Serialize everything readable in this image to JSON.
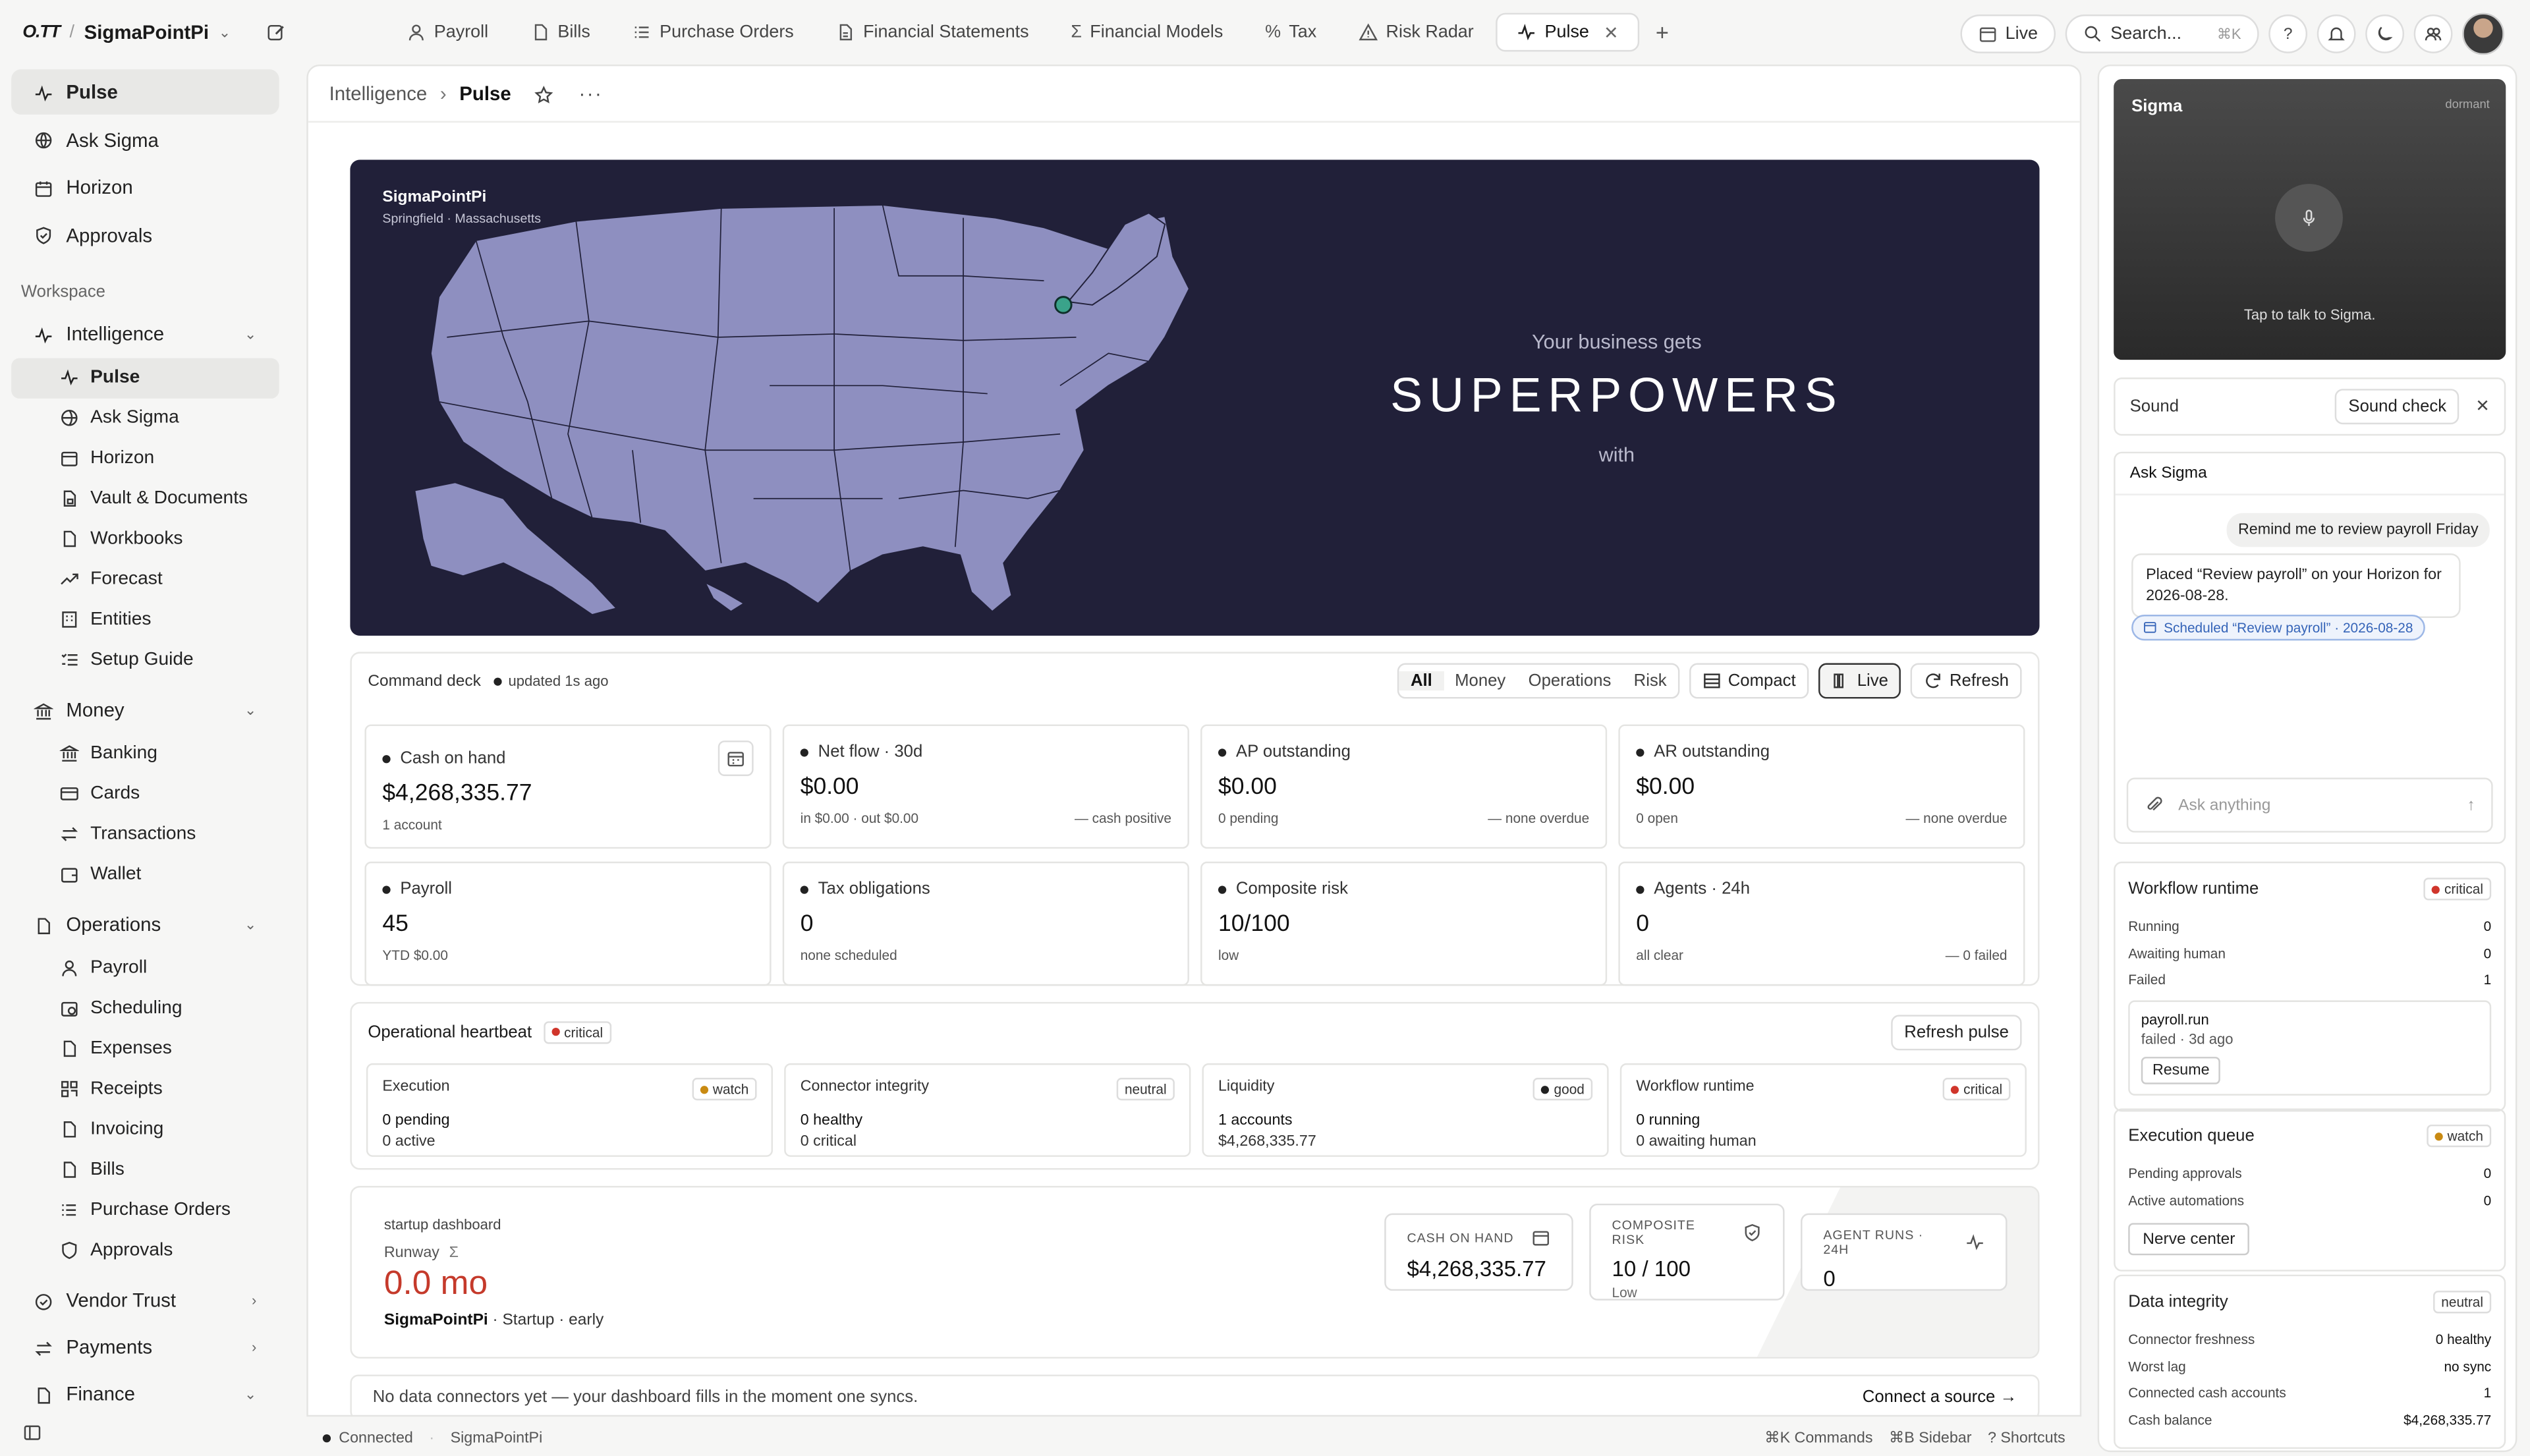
{
  "app": {
    "logo": "O.TT",
    "org": "SigmaPointPi"
  },
  "tabs": [
    {
      "label": "Payroll",
      "icon": "users-icon"
    },
    {
      "label": "Bills",
      "icon": "file-icon"
    },
    {
      "label": "Purchase Orders",
      "icon": "list-icon"
    },
    {
      "label": "Financial Statements",
      "icon": "document-icon"
    },
    {
      "label": "Financial Models",
      "icon": "sigma-icon"
    },
    {
      "label": "Tax",
      "icon": "percent-icon"
    },
    {
      "label": "Risk Radar",
      "icon": "warning-icon"
    },
    {
      "label": "Pulse",
      "icon": "pulse-icon",
      "active": true
    }
  ],
  "topright": {
    "live": "Live",
    "search_placeholder": "Search...",
    "search_kbd": "⌘K"
  },
  "sidebar": {
    "top": [
      "Pulse",
      "Ask Sigma",
      "Horizon",
      "Approvals"
    ],
    "workspace_label": "Workspace",
    "intelligence": {
      "label": "Intelligence",
      "items": [
        "Pulse",
        "Ask Sigma",
        "Horizon",
        "Vault & Documents",
        "Workbooks",
        "Forecast",
        "Entities",
        "Setup Guide"
      ]
    },
    "money": {
      "label": "Money",
      "items": [
        "Banking",
        "Cards",
        "Transactions",
        "Wallet"
      ]
    },
    "operations": {
      "label": "Operations",
      "items": [
        "Payroll",
        "Scheduling",
        "Expenses",
        "Receipts",
        "Invoicing",
        "Bills",
        "Purchase Orders",
        "Approvals"
      ]
    },
    "collapsed": [
      "Vendor Trust",
      "Payments",
      "Finance"
    ]
  },
  "breadcrumb": {
    "parent": "Intelligence",
    "current": "Pulse"
  },
  "hero": {
    "name": "SigmaPointPi",
    "location": "Springfield · Massachusetts",
    "line1": "Your business gets",
    "line2": "SUPERPOWERS",
    "line3": "with"
  },
  "deck": {
    "title": "Command deck",
    "updated": "updated 1s ago",
    "filters": [
      "All",
      "Money",
      "Operations",
      "Risk"
    ],
    "compact": "Compact",
    "live": "Live",
    "refresh": "Refresh",
    "cards": [
      {
        "label": "Cash on hand",
        "value": "$4,268,335.77",
        "sub": "1 account",
        "note": ""
      },
      {
        "label": "Net flow · 30d",
        "value": "$0.00",
        "sub": "in $0.00 · out $0.00",
        "note": "cash positive"
      },
      {
        "label": "AP outstanding",
        "value": "$0.00",
        "sub": "0 pending",
        "note": "none overdue"
      },
      {
        "label": "AR outstanding",
        "value": "$0.00",
        "sub": "0 open",
        "note": "none overdue"
      },
      {
        "label": "Payroll",
        "value": "45",
        "sub": "YTD $0.00",
        "note": ""
      },
      {
        "label": "Tax obligations",
        "value": "0",
        "sub": "none scheduled",
        "note": ""
      },
      {
        "label": "Composite risk",
        "value": "10/100",
        "sub": "low",
        "note": ""
      },
      {
        "label": "Agents · 24h",
        "value": "0",
        "sub": "all clear",
        "note": "0 failed"
      }
    ]
  },
  "heartbeat": {
    "title": "Operational heartbeat",
    "status": "critical",
    "refresh": "Refresh pulse",
    "cards": [
      {
        "label": "Execution",
        "badge": "watch",
        "badge_color": "#c98a12",
        "l1": "0 pending",
        "l2": "0 active"
      },
      {
        "label": "Connector integrity",
        "badge": "neutral",
        "badge_color": "",
        "l1": "0 healthy",
        "l2": "0 critical"
      },
      {
        "label": "Liquidity",
        "badge": "good",
        "badge_color": "#222222",
        "l1": "1 accounts",
        "l2": "$4,268,335.77"
      },
      {
        "label": "Workflow runtime",
        "badge": "critical",
        "badge_color": "#d0352b",
        "l1": "0 running",
        "l2": "0 awaiting human"
      }
    ]
  },
  "startup": {
    "kind": "startup dashboard",
    "runway_label": "Runway",
    "runway_value": "0.0 mo",
    "company": "SigmaPointPi",
    "meta": " · Startup · early",
    "cash_label": "CASH ON HAND",
    "cash_value": "$4,268,335.77",
    "risk_label": "COMPOSITE RISK",
    "risk_value": "10 / 100",
    "risk_sub": "Low",
    "agent_label": "AGENT RUNS · 24H",
    "agent_value": "0"
  },
  "noconn": {
    "message": "No data connectors yet — your dashboard fills in the moment one syncs.",
    "cta": "Connect a source →"
  },
  "statusbar": {
    "connected": "Connected",
    "org": "SigmaPointPi",
    "commands": "⌘K Commands",
    "sidebar": "⌘B Sidebar",
    "shortcuts": "? Shortcuts"
  },
  "voice": {
    "title": "Sigma",
    "state": "dormant",
    "hint": "Tap to talk to Sigma."
  },
  "sound": {
    "label": "Sound",
    "check": "Sound check"
  },
  "ask": {
    "title": "Ask Sigma",
    "user_msg": "Remind me to review payroll Friday",
    "ai_msg": "Placed “Review payroll” on your Horizon for 2026-08-28.",
    "scheduled": "Scheduled “Review payroll” · 2026-08-28",
    "placeholder": "Ask anything"
  },
  "workflow": {
    "title": "Workflow runtime",
    "badge": "critical",
    "rows": [
      {
        "k": "Running",
        "v": "0"
      },
      {
        "k": "Awaiting human",
        "v": "0"
      },
      {
        "k": "Failed",
        "v": "1"
      }
    ],
    "fail_name": "payroll.run",
    "fail_status": "failed · 3d ago",
    "resume": "Resume"
  },
  "queue": {
    "title": "Execution queue",
    "badge": "watch",
    "rows": [
      {
        "k": "Pending approvals",
        "v": "0"
      },
      {
        "k": "Active automations",
        "v": "0"
      }
    ],
    "nerve": "Nerve center"
  },
  "integrity": {
    "title": "Data integrity",
    "badge": "neutral",
    "rows": [
      {
        "k": "Connector freshness",
        "v": "0 healthy"
      },
      {
        "k": "Worst lag",
        "v": "no sync"
      },
      {
        "k": "Connected cash accounts",
        "v": "1"
      },
      {
        "k": "Cash balance",
        "v": "$4,268,335.77"
      }
    ]
  },
  "colors": {
    "hero_bg": "#212039",
    "map_fill": "#8e8fc0",
    "critical": "#d0352b",
    "watch": "#c98a12",
    "runway": "#c53a2b",
    "sched_blue": "#3564b8"
  }
}
